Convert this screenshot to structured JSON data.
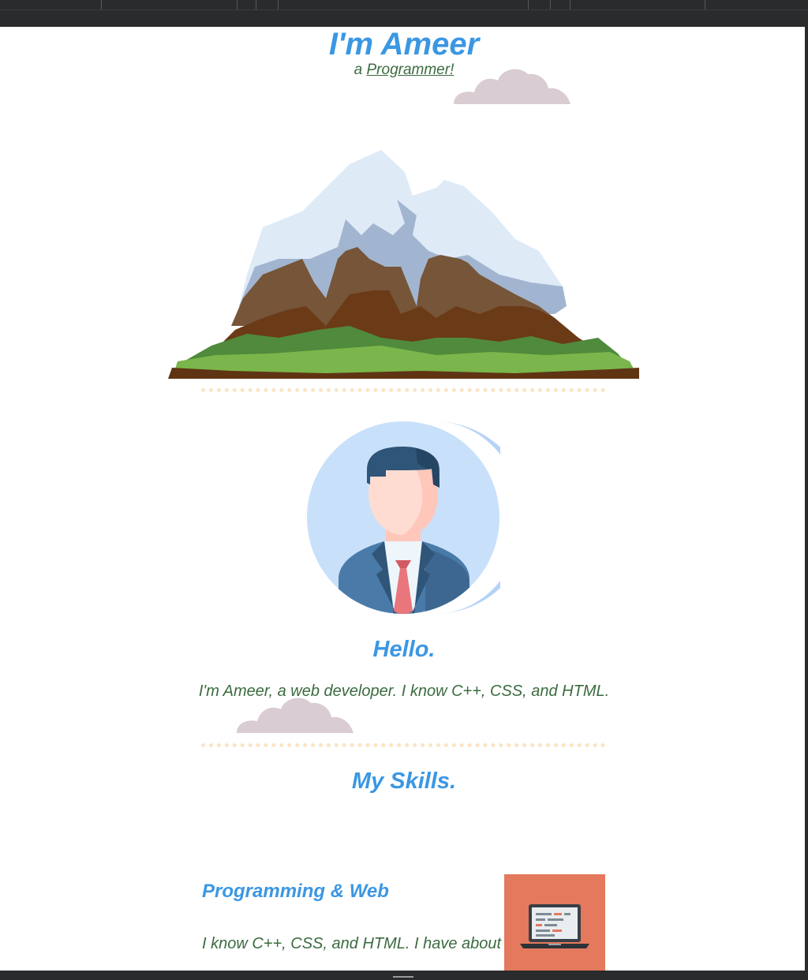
{
  "header": {
    "title": "I'm Ameer",
    "subtitle_prefix": "a",
    "subtitle_link": "Programmer!"
  },
  "images": {
    "cloud_icon": "cloud-icon",
    "mountain_icon": "mountain-icon",
    "avatar_icon": "businessman-avatar-icon",
    "laptop_icon": "laptop-icon"
  },
  "about": {
    "heading": "Hello.",
    "text": "I'm Ameer, a web developer. I know C++, CSS, and HTML."
  },
  "skills": {
    "heading": "My Skills.",
    "items": [
      {
        "title": "Programming & Web",
        "text": "I know C++, CSS, and HTML. I have about"
      }
    ]
  },
  "colors": {
    "heading_blue": "#3b97e3",
    "text_green": "#3b6b3f",
    "dotted_divider": "#fde3c5",
    "cloud": "#d9ccd2",
    "skill_tile": "#e4795e",
    "window_chrome": "#2a2b2d"
  }
}
